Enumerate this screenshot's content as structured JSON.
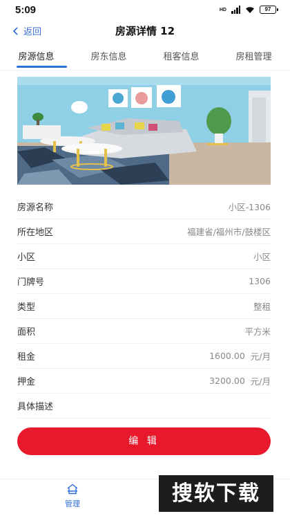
{
  "status_bar": {
    "time": "5:09",
    "network": "HD",
    "battery": "97"
  },
  "nav": {
    "back_label": "返回",
    "title": "房源详情 12"
  },
  "tabs": [
    {
      "label": "房源信息",
      "active": true
    },
    {
      "label": "房东信息",
      "active": false
    },
    {
      "label": "租客信息",
      "active": false
    },
    {
      "label": "房租管理",
      "active": false
    }
  ],
  "details": [
    {
      "label": "房源名称",
      "value": "小区-1306",
      "unit": ""
    },
    {
      "label": "所在地区",
      "value": "福建省/福州市/鼓楼区",
      "unit": ""
    },
    {
      "label": "小区",
      "value": "小区",
      "unit": ""
    },
    {
      "label": "门牌号",
      "value": "1306",
      "unit": ""
    },
    {
      "label": "类型",
      "value": "整租",
      "unit": ""
    },
    {
      "label": "面积",
      "value": "平方米",
      "unit": ""
    },
    {
      "label": "租金",
      "value": "1600.00",
      "unit": "元/月"
    },
    {
      "label": "押金",
      "value": "3200.00",
      "unit": "元/月"
    },
    {
      "label": "具体描述",
      "value": "",
      "unit": ""
    }
  ],
  "edit_label": "编 辑",
  "bottom_nav": {
    "manage_label": "管理"
  },
  "watermark": "搜软下载",
  "colors": {
    "accent": "#2f6ed8",
    "button": "#e8192c",
    "wall": "#8fd0e6"
  },
  "icons": {
    "back": "chevron-left-icon",
    "manage": "home-icon"
  }
}
